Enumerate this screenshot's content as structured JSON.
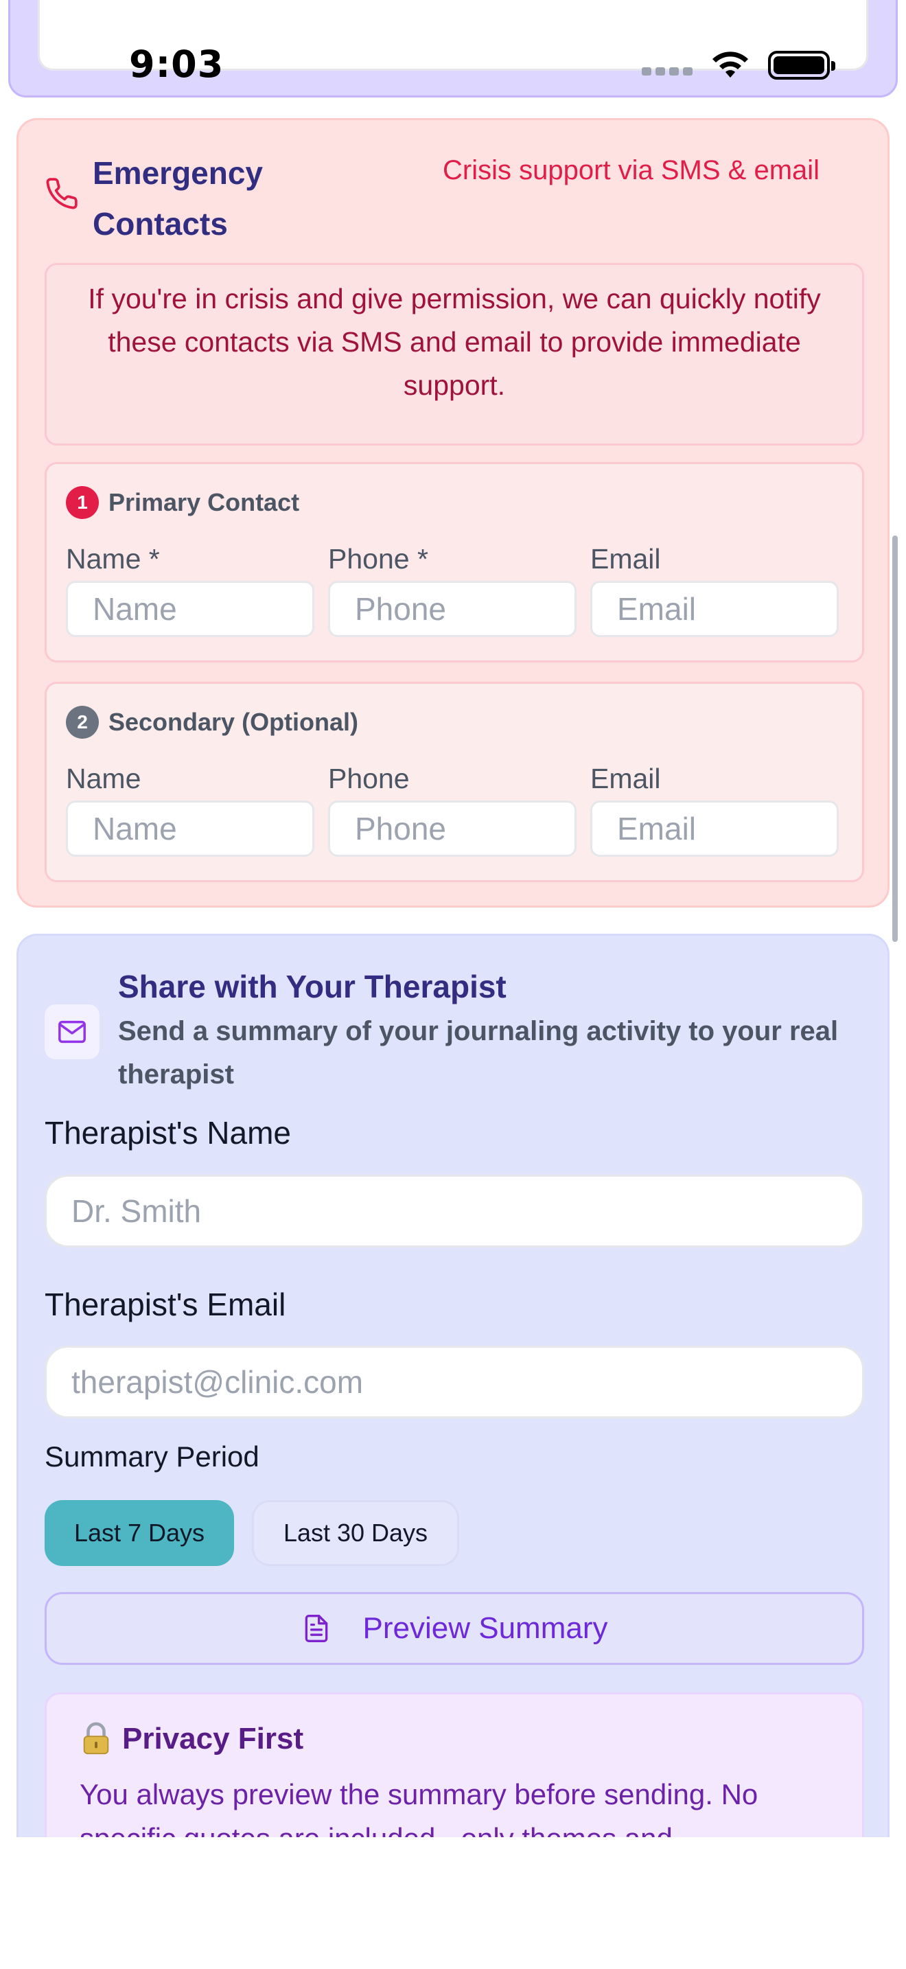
{
  "status_bar": {
    "time": "9:03"
  },
  "emergency": {
    "title": "Emergency Contacts",
    "subtitle": "Crisis support via SMS & email",
    "note": "If you're in crisis and give permission, we can quickly notify these contacts via SMS and email to provide immediate support.",
    "primary": {
      "number": "1",
      "heading": "Primary Contact",
      "name_label": "Name *",
      "phone_label": "Phone *",
      "email_label": "Email",
      "name_placeholder": "Name",
      "phone_placeholder": "Phone",
      "email_placeholder": "Email"
    },
    "secondary": {
      "number": "2",
      "heading": "Secondary (Optional)",
      "name_label": "Name",
      "phone_label": "Phone",
      "email_label": "Email",
      "name_placeholder": "Name",
      "phone_placeholder": "Phone",
      "email_placeholder": "Email"
    },
    "colors": {
      "accent": "#e11d48",
      "background": "#fee2e2"
    }
  },
  "therapist": {
    "title": "Share with Your Therapist",
    "description": "Send a summary of your journaling activity to your real therapist",
    "name_label": "Therapist's Name",
    "name_placeholder": "Dr. Smith",
    "email_label": "Therapist's Email",
    "email_placeholder": "therapist@clinic.com",
    "period_label": "Summary Period",
    "period_options": [
      "Last 7 Days",
      "Last 30 Days"
    ],
    "period_selected": "Last 7 Days",
    "preview_button": "Preview Summary",
    "privacy": {
      "icon": "lock-icon",
      "heading": "Privacy First",
      "text": "You always preview the summary before sending. No specific quotes are included - only themes and"
    },
    "colors": {
      "accent": "#4db6c2",
      "background": "#e0e3fc",
      "button_text": "#6d28d9"
    }
  },
  "icons": [
    "phone-icon",
    "mail-icon",
    "document-icon",
    "lock-icon",
    "wifi-icon",
    "battery-icon",
    "signal-icon"
  ]
}
